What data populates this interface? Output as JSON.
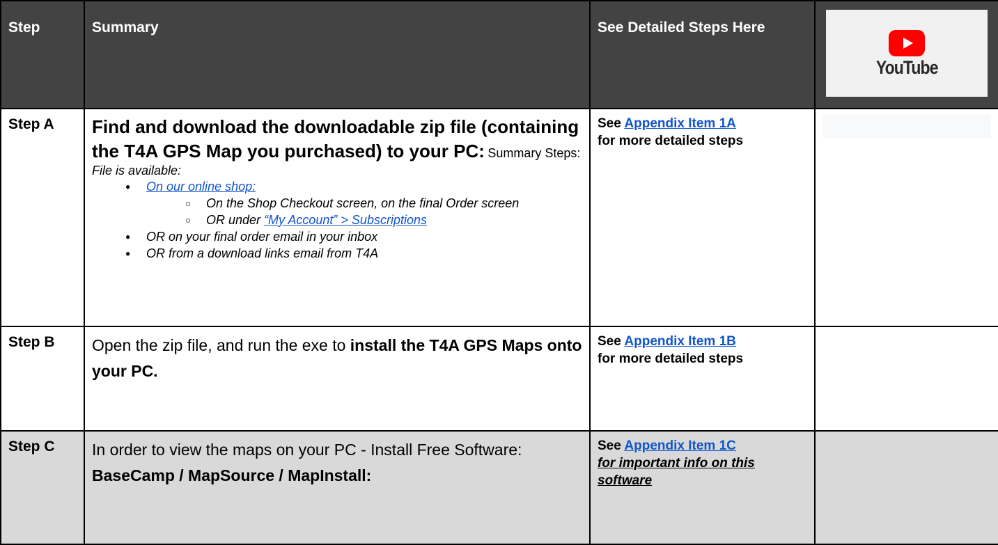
{
  "header": {
    "step": "Step",
    "summary": "Summary",
    "detail": "See Detailed Steps Here",
    "youtube_word": "YouTube"
  },
  "rows": [
    {
      "step": "Step A",
      "title": "Find and download the downloadable zip file (containing the T4A GPS Map you purchased) to your PC:",
      "summary_prefix": "Summary Steps:",
      "file_avail": "File is available:",
      "bullet1_link": "On our online shop:",
      "sub1": "On the Shop Checkout screen, on the final Order screen",
      "sub2_prefix": "OR under",
      "sub2_link": "“My Account” > Subscriptions",
      "bullet2": "OR on your final order email in your inbox",
      "bullet3": "OR from a download links email from T4A",
      "see": "See",
      "link": "Appendix Item 1A",
      "more": "for more detailed steps"
    },
    {
      "step": "Step B",
      "text1": "Open the zip file, and run the exe to",
      "text2": "install the T4A GPS Maps onto your PC.",
      "see": "See",
      "link": "Appendix Item 1B",
      "more": "for more detailed steps"
    },
    {
      "step": "Step C",
      "text1": "In order to view the maps on your PC - Install Free Software:",
      "text2": "BaseCamp / MapSource / MapInstall:",
      "see": "See",
      "link": "Appendix Item 1C",
      "more": "for important info on this software"
    }
  ],
  "colors": {
    "header_bg": "#434343",
    "row_c_bg": "#d9d9d9",
    "link": "#1155cc",
    "youtube_red": "#ff0000"
  }
}
